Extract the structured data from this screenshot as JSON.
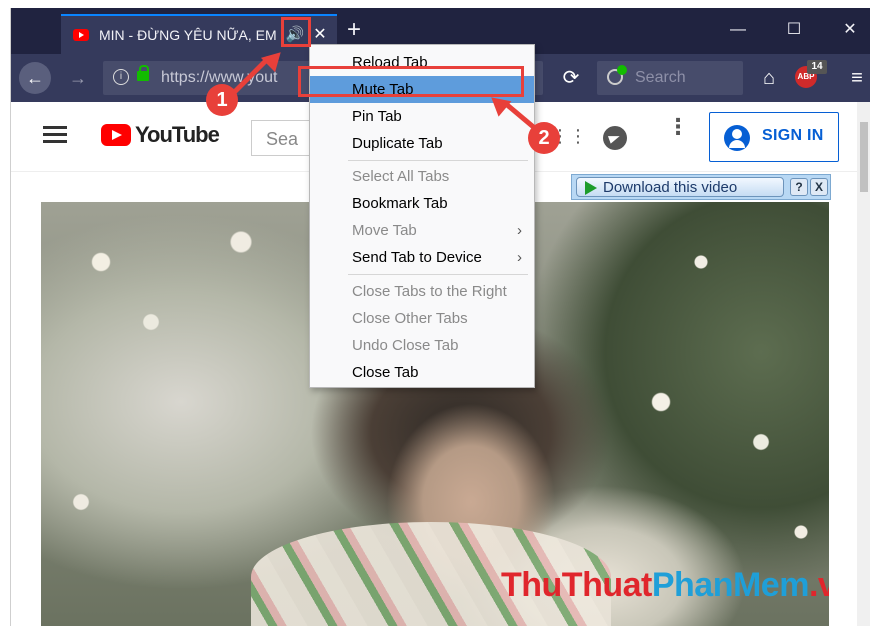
{
  "browser": {
    "tab": {
      "title": "MIN - ĐỪNG YÊU NỮA, EM",
      "favicon": "youtube-icon",
      "audio_icon": "🔊",
      "close_icon": "✕"
    },
    "new_tab_icon": "+",
    "window": {
      "minimize": "—",
      "maximize": "☐",
      "close": "✕"
    },
    "nav": {
      "back_icon": "←",
      "forward_icon": "→",
      "reload_icon": "⟳",
      "home_icon": "⌂",
      "menu_icon": "≡",
      "url": "https://www.yout",
      "info_icon": "i",
      "star_icon": "☆",
      "search_placeholder": "Search",
      "adblock_label": "ABP",
      "adblock_count": "14"
    }
  },
  "youtube": {
    "logo_text": "YouTube",
    "search_placeholder": "Sea",
    "apps_icon": "⋮⋮",
    "more_icon": "⋮",
    "sign_in": "SIGN IN"
  },
  "download_bar": {
    "label": "Download this video",
    "help": "?",
    "close": "X"
  },
  "watermark": {
    "part1": "ThuThuat",
    "part2": "PhanMem",
    "part3": ".vn"
  },
  "context_menu": {
    "items": [
      {
        "label": "Reload Tab",
        "disabled": false
      },
      {
        "label": "Mute Tab",
        "disabled": false,
        "highlighted": true
      },
      {
        "label": "Pin Tab",
        "disabled": false
      },
      {
        "label": "Duplicate Tab",
        "disabled": false
      },
      {
        "label": "Select All Tabs",
        "disabled": true
      },
      {
        "label": "Bookmark Tab",
        "disabled": false
      },
      {
        "label": "Move Tab",
        "disabled": true,
        "submenu": true
      },
      {
        "label": "Send Tab to Device",
        "disabled": false,
        "submenu": true
      },
      {
        "label": "Close Tabs to the Right",
        "disabled": true
      },
      {
        "label": "Close Other Tabs",
        "disabled": true
      },
      {
        "label": "Undo Close Tab",
        "disabled": true
      },
      {
        "label": "Close Tab",
        "disabled": false
      }
    ],
    "submenu_arrow": "›"
  },
  "annotations": {
    "step1": "1",
    "step2": "2"
  },
  "colors": {
    "accent_red": "#e8403a",
    "tab_bg": "#353a5c",
    "titlebar": "#202340",
    "highlight": "#5e9cdc"
  }
}
